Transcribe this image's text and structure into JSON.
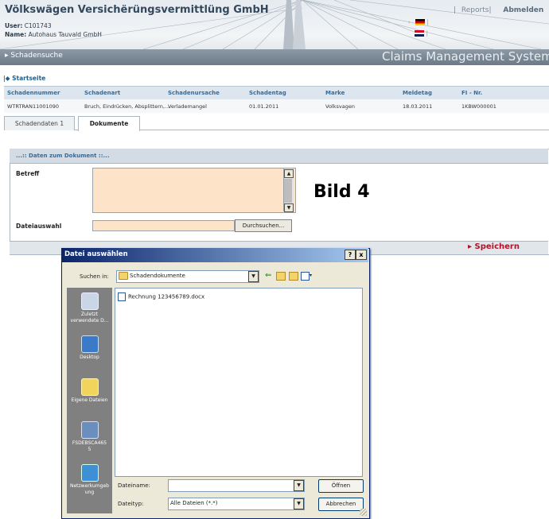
{
  "header": {
    "company": "Völkswägen Versichërüngsvermittlüng GmbH",
    "user_label": "User:",
    "user_value": "C101743",
    "name_label": "Name:",
    "name_value": "Autohaus Tauvald GmbH",
    "reports_link": "Reports|",
    "logout_link": "Abmelden",
    "nav_search": "▸ Schadensuche",
    "system_title": "Claims Management System"
  },
  "breadcrumb": {
    "home": "|◆ Startseite"
  },
  "table": {
    "columns": [
      "Schadennummer",
      "Schadenart",
      "Schadenursache",
      "Schadentag",
      "Marke",
      "Meldetag",
      "FI - Nr."
    ],
    "row": [
      "WTRTRAN11001090",
      "Bruch, Eindrücken, Absplittern,...",
      "Verlademangel",
      "01.01.2011",
      "Volksvagen",
      "18.03.2011",
      "1KBW000001"
    ]
  },
  "tabs": [
    {
      "label": "Schadendaten 1"
    },
    {
      "label": "Dokumente"
    }
  ],
  "form": {
    "title": "...:: Daten zum Dokument ::...",
    "betreff_label": "Betreff",
    "datei_label": "Dateiauswahl",
    "browse_button": "Durchsuchen...",
    "save_link": "▸ Speichern"
  },
  "annotation": "Bild 4",
  "dialog": {
    "title": "Datei auswählen",
    "help_button": "?",
    "close_button": "x",
    "look_in_label": "Suchen in:",
    "look_in_value": "Schadendokumente",
    "places": [
      "Zuletzt verwendete D...",
      "Desktop",
      "Eigene Dateien",
      "FSDEBSCA4655",
      "Netzwerkumgebung"
    ],
    "places_display": [
      "Zuletzt\nverwendete D...",
      "Desktop",
      "Eigene Dateien",
      "FSDEBSCA465\n5",
      "Netzwerkumgeb\nung"
    ],
    "files": [
      "Rechnung 123456789.docx"
    ],
    "filename_label": "Dateiname:",
    "filename_value": "",
    "filetype_label": "Dateityp:",
    "filetype_value": "Alle Dateien (*.*)",
    "open_button": "Öffnen",
    "cancel_button": "Abbrechen"
  },
  "icons": {
    "folder": "folder-icon",
    "back": "back-arrow-icon",
    "up": "up-folder-icon",
    "new_folder": "new-folder-icon",
    "view": "view-menu-icon"
  },
  "colors": {
    "header_bg": "#e6ebf0",
    "nav_bar": "#7a8794",
    "table_header": "#dde6ee",
    "input_bg": "#fde3c7",
    "save_link": "#b0132b",
    "dialog_title": "#0a246a",
    "places_bar": "#808080"
  }
}
